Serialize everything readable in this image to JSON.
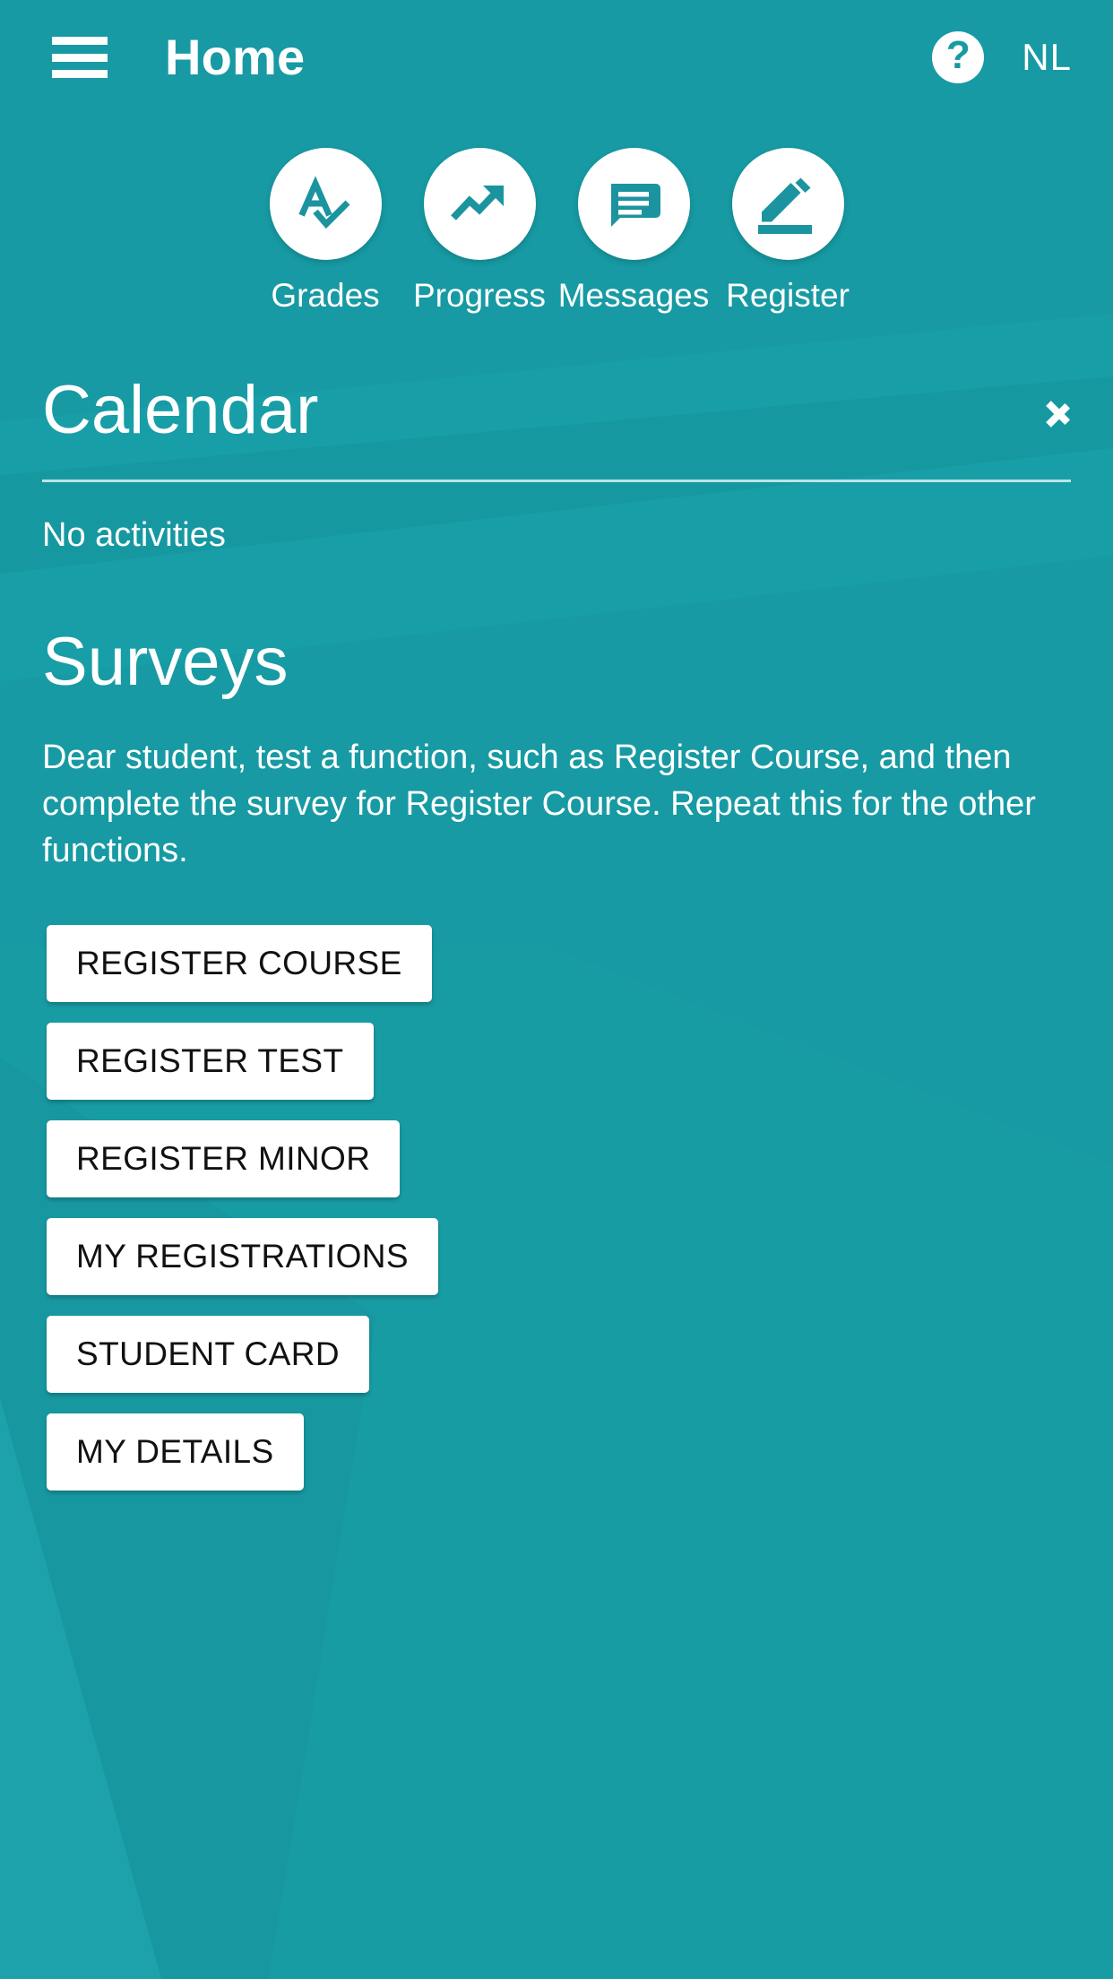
{
  "theme": {
    "brand_teal": "#179aa3",
    "brand_teal_light": "#1ba3ab",
    "surface_white": "#ffffff",
    "text_dark": "#111111"
  },
  "appbar": {
    "menu_icon": "hamburger-menu-icon",
    "title": "Home",
    "help_icon": "help-question-icon",
    "help_glyph": "?",
    "language": "NL"
  },
  "shortcuts": [
    {
      "label": "Grades",
      "icon": "grade-a-check-icon"
    },
    {
      "label": "Progress",
      "icon": "trending-up-icon"
    },
    {
      "label": "Messages",
      "icon": "message-bubble-icon"
    },
    {
      "label": "Register",
      "icon": "pencil-edit-icon"
    }
  ],
  "calendar": {
    "title": "Calendar",
    "chevron_icon": "chevron-right-icon",
    "empty_text": "No activities"
  },
  "surveys": {
    "title": "Surveys",
    "description": "Dear student, test a function, such as Register Course, and then complete the survey for Register Course. Repeat this for the other functions.",
    "buttons": [
      {
        "label": "REGISTER COURSE"
      },
      {
        "label": "REGISTER TEST"
      },
      {
        "label": "REGISTER MINOR"
      },
      {
        "label": "MY REGISTRATIONS"
      },
      {
        "label": "STUDENT CARD"
      },
      {
        "label": "MY DETAILS"
      }
    ]
  }
}
